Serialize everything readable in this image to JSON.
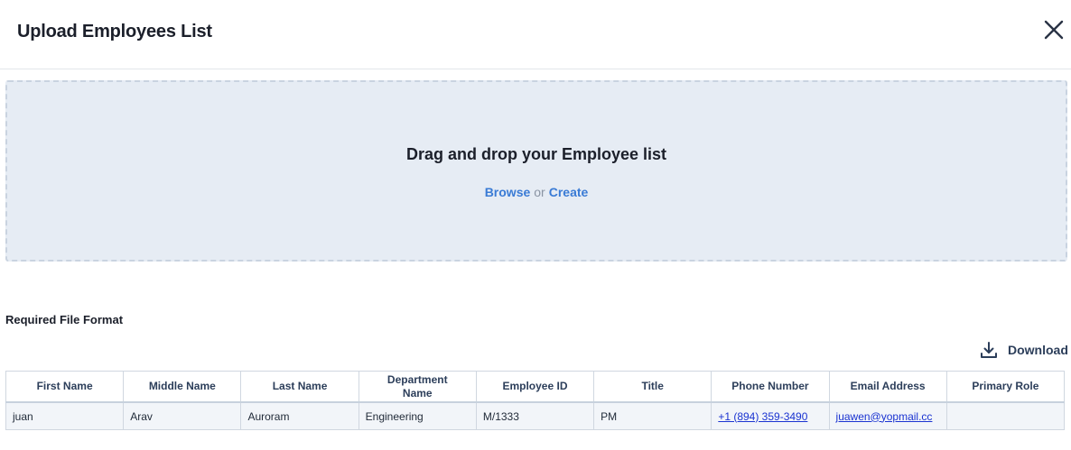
{
  "modal": {
    "title": "Upload Employees List"
  },
  "dropzone": {
    "title": "Drag and drop your Employee list",
    "browse_label": "Browse",
    "or_label": "or",
    "create_label": "Create"
  },
  "format": {
    "heading": "Required File Format",
    "download_label": "Download"
  },
  "table": {
    "headers": [
      "First Name",
      "Middle Name",
      "Last Name",
      "Department Name",
      "Employee ID",
      "Title",
      "Phone Number",
      "Email Address",
      "Primary Role"
    ],
    "rows": [
      [
        "juan",
        "Arav",
        "Auroram",
        "Engineering",
        "M/1333",
        "PM",
        "+1 (894) 359-3490",
        "juawen@yopmail.cc",
        ""
      ]
    ]
  },
  "colors": {
    "accent_link": "#3a7bd5",
    "dropzone_bg": "#e6ecf4",
    "table_link": "#1a33d1"
  }
}
